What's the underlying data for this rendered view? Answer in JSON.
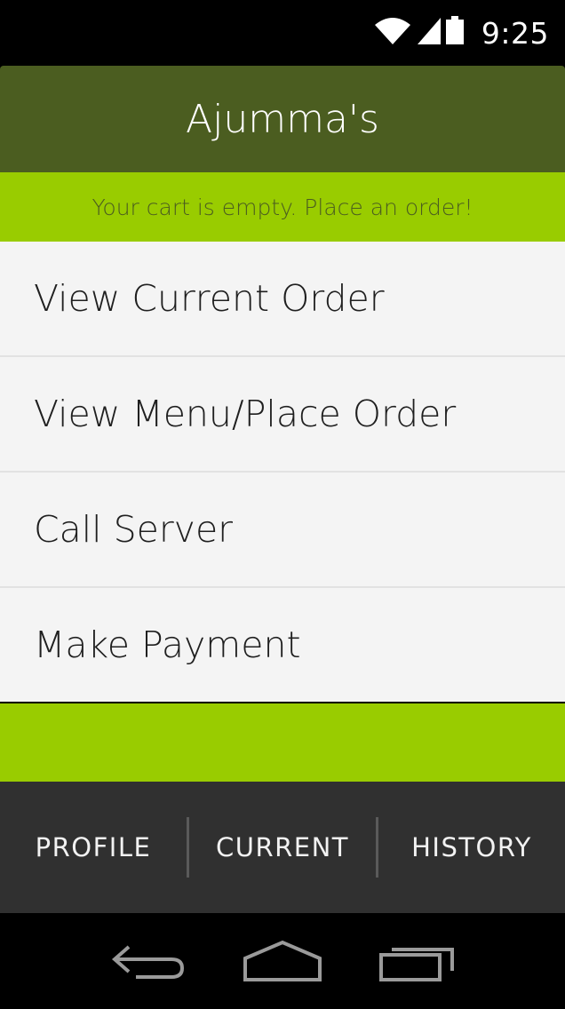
{
  "status_bar": {
    "time": "9:25",
    "icons": [
      "wifi-icon",
      "signal-icon",
      "battery-icon"
    ]
  },
  "header": {
    "title": "Ajumma's"
  },
  "cart_banner": {
    "message": "Your cart is empty. Place an order!"
  },
  "menu": {
    "items": [
      {
        "label": "View Current Order"
      },
      {
        "label": "View Menu/Place Order"
      },
      {
        "label": "Call Server"
      },
      {
        "label": "Make Payment"
      }
    ]
  },
  "tabs": [
    {
      "label": "PROFILE"
    },
    {
      "label": "CURRENT"
    },
    {
      "label": "HISTORY"
    }
  ],
  "nav_bar": {
    "icons": [
      "back-icon",
      "home-icon",
      "recents-icon"
    ]
  },
  "colors": {
    "header_bg": "#4b5d20",
    "accent_green": "#99cc00",
    "tab_bar_bg": "#303030",
    "menu_item_bg": "#f4f4f4"
  }
}
